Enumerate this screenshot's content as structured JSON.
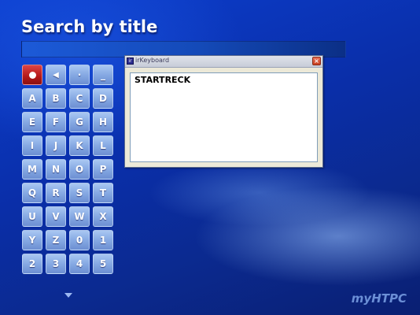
{
  "screen": {
    "title": "Search by title",
    "logo": "myHTPC"
  },
  "keypad": {
    "controls": [
      {
        "name": "record-button",
        "label": ""
      },
      {
        "name": "backspace-button",
        "label": "◀"
      },
      {
        "name": "dot-key",
        "label": "·"
      },
      {
        "name": "underscore-key",
        "label": "_"
      }
    ],
    "keys": [
      "A",
      "B",
      "C",
      "D",
      "E",
      "F",
      "G",
      "H",
      "I",
      "J",
      "K",
      "L",
      "M",
      "N",
      "O",
      "P",
      "Q",
      "R",
      "S",
      "T",
      "U",
      "V",
      "W",
      "X",
      "Y",
      "Z",
      "0",
      "1",
      "2",
      "3",
      "4",
      "5"
    ]
  },
  "popup": {
    "title": "irKeyboard",
    "close_label": "×",
    "text": "STARTRECK"
  },
  "colors": {
    "background": "#0a2fa8",
    "record": "#b41818",
    "key": "#86a9e3"
  }
}
